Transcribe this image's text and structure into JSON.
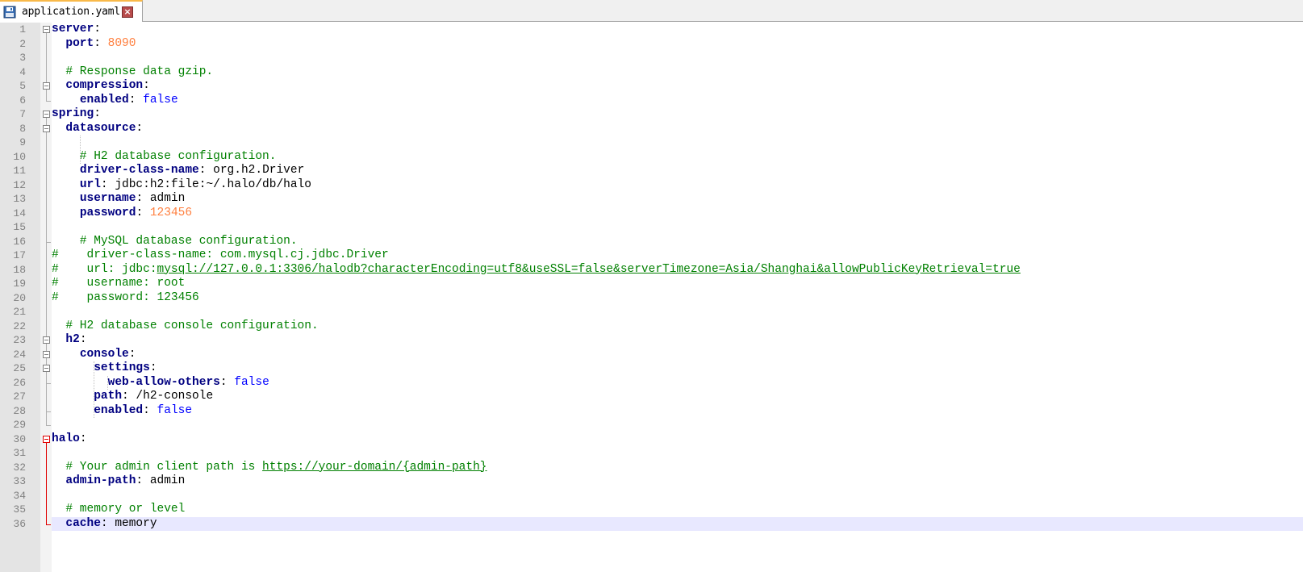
{
  "tab": {
    "filename": "application.yaml",
    "icon": "save-disk-icon",
    "close_icon": "close-icon"
  },
  "colors": {
    "key": "#000080",
    "comment": "#008000",
    "number": "#ff8040",
    "boolean": "#0000ff",
    "gutter": "#e4e4e4",
    "current_line": "#e8e8ff",
    "fold_active": "#e00000"
  },
  "current_line": 36,
  "lines": [
    {
      "n": "1",
      "tokens": [
        {
          "t": "k",
          "v": "server"
        },
        {
          "t": "t",
          "v": ":"
        }
      ]
    },
    {
      "n": "2",
      "tokens": [
        {
          "t": "t",
          "v": "  "
        },
        {
          "t": "k",
          "v": "port"
        },
        {
          "t": "t",
          "v": ": "
        },
        {
          "t": "n",
          "v": "8090"
        }
      ]
    },
    {
      "n": "3",
      "tokens": []
    },
    {
      "n": "4",
      "tokens": [
        {
          "t": "c",
          "v": "  # Response data gzip."
        }
      ]
    },
    {
      "n": "5",
      "tokens": [
        {
          "t": "t",
          "v": "  "
        },
        {
          "t": "k",
          "v": "compression"
        },
        {
          "t": "t",
          "v": ":"
        }
      ]
    },
    {
      "n": "6",
      "tokens": [
        {
          "t": "t",
          "v": "    "
        },
        {
          "t": "k",
          "v": "enabled"
        },
        {
          "t": "t",
          "v": ": "
        },
        {
          "t": "b",
          "v": "false"
        }
      ]
    },
    {
      "n": "7",
      "tokens": [
        {
          "t": "k",
          "v": "spring"
        },
        {
          "t": "t",
          "v": ":"
        }
      ]
    },
    {
      "n": "8",
      "tokens": [
        {
          "t": "t",
          "v": "  "
        },
        {
          "t": "k",
          "v": "datasource"
        },
        {
          "t": "t",
          "v": ":"
        }
      ]
    },
    {
      "n": "9",
      "tokens": []
    },
    {
      "n": "10",
      "tokens": [
        {
          "t": "c",
          "v": "    # H2 database configuration."
        }
      ]
    },
    {
      "n": "11",
      "tokens": [
        {
          "t": "t",
          "v": "    "
        },
        {
          "t": "k",
          "v": "driver-class-name"
        },
        {
          "t": "t",
          "v": ": org.h2.Driver"
        }
      ]
    },
    {
      "n": "12",
      "tokens": [
        {
          "t": "t",
          "v": "    "
        },
        {
          "t": "k",
          "v": "url"
        },
        {
          "t": "t",
          "v": ": jdbc:h2:file:~/.halo/db/halo"
        }
      ]
    },
    {
      "n": "13",
      "tokens": [
        {
          "t": "t",
          "v": "    "
        },
        {
          "t": "k",
          "v": "username"
        },
        {
          "t": "t",
          "v": ": admin"
        }
      ]
    },
    {
      "n": "14",
      "tokens": [
        {
          "t": "t",
          "v": "    "
        },
        {
          "t": "k",
          "v": "password"
        },
        {
          "t": "t",
          "v": ": "
        },
        {
          "t": "n",
          "v": "123456"
        }
      ]
    },
    {
      "n": "15",
      "tokens": []
    },
    {
      "n": "16",
      "tokens": [
        {
          "t": "c",
          "v": "    # MySQL database configuration."
        }
      ]
    },
    {
      "n": "17",
      "tokens": [
        {
          "t": "c",
          "v": "#    driver-class-name: com.mysql.cj.jdbc.Driver"
        }
      ]
    },
    {
      "n": "18",
      "tokens": [
        {
          "t": "c",
          "v": "#    url: jdbc:"
        },
        {
          "t": "u",
          "v": "mysql://127.0.0.1:3306/halodb?characterEncoding=utf8&useSSL=false&serverTimezone=Asia/Shanghai&allowPublicKeyRetrieval=true"
        }
      ]
    },
    {
      "n": "19",
      "tokens": [
        {
          "t": "c",
          "v": "#    username: root"
        }
      ]
    },
    {
      "n": "20",
      "tokens": [
        {
          "t": "c",
          "v": "#    password: 123456"
        }
      ]
    },
    {
      "n": "21",
      "tokens": []
    },
    {
      "n": "22",
      "tokens": [
        {
          "t": "c",
          "v": "  # H2 database console configuration."
        }
      ]
    },
    {
      "n": "23",
      "tokens": [
        {
          "t": "t",
          "v": "  "
        },
        {
          "t": "k",
          "v": "h2"
        },
        {
          "t": "t",
          "v": ":"
        }
      ]
    },
    {
      "n": "24",
      "tokens": [
        {
          "t": "t",
          "v": "    "
        },
        {
          "t": "k",
          "v": "console"
        },
        {
          "t": "t",
          "v": ":"
        }
      ]
    },
    {
      "n": "25",
      "tokens": [
        {
          "t": "t",
          "v": "      "
        },
        {
          "t": "k",
          "v": "settings"
        },
        {
          "t": "t",
          "v": ":"
        }
      ]
    },
    {
      "n": "26",
      "tokens": [
        {
          "t": "t",
          "v": "        "
        },
        {
          "t": "k",
          "v": "web-allow-others"
        },
        {
          "t": "t",
          "v": ": "
        },
        {
          "t": "b",
          "v": "false"
        }
      ]
    },
    {
      "n": "27",
      "tokens": [
        {
          "t": "t",
          "v": "      "
        },
        {
          "t": "k",
          "v": "path"
        },
        {
          "t": "t",
          "v": ": /h2-console"
        }
      ]
    },
    {
      "n": "28",
      "tokens": [
        {
          "t": "t",
          "v": "      "
        },
        {
          "t": "k",
          "v": "enabled"
        },
        {
          "t": "t",
          "v": ": "
        },
        {
          "t": "b",
          "v": "false"
        }
      ]
    },
    {
      "n": "29",
      "tokens": []
    },
    {
      "n": "30",
      "tokens": [
        {
          "t": "k",
          "v": "halo"
        },
        {
          "t": "t",
          "v": ":"
        }
      ]
    },
    {
      "n": "31",
      "tokens": []
    },
    {
      "n": "32",
      "tokens": [
        {
          "t": "c",
          "v": "  # Your admin client path is "
        },
        {
          "t": "u",
          "v": "https://your-domain/{admin-path}"
        }
      ]
    },
    {
      "n": "33",
      "tokens": [
        {
          "t": "t",
          "v": "  "
        },
        {
          "t": "k",
          "v": "admin-path"
        },
        {
          "t": "t",
          "v": ": admin"
        }
      ]
    },
    {
      "n": "34",
      "tokens": []
    },
    {
      "n": "35",
      "tokens": [
        {
          "t": "c",
          "v": "  # memory or level"
        }
      ]
    },
    {
      "n": "36",
      "tokens": [
        {
          "t": "t",
          "v": "  "
        },
        {
          "t": "k",
          "v": "cache"
        },
        {
          "t": "t",
          "v": ": memory"
        }
      ]
    }
  ]
}
